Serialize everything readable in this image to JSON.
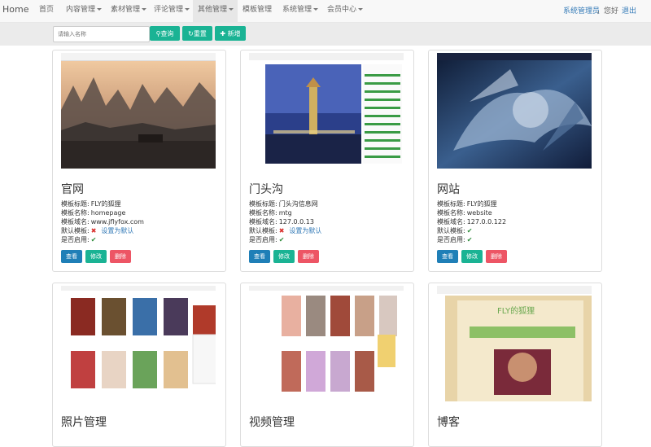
{
  "navbar": {
    "brand": "Home",
    "items": [
      {
        "label": "首页",
        "caret": false
      },
      {
        "label": "内容管理",
        "caret": true
      },
      {
        "label": "素材管理",
        "caret": true
      },
      {
        "label": "评论管理",
        "caret": true
      },
      {
        "label": "其他管理",
        "caret": true
      },
      {
        "label": "模板管理",
        "caret": false
      },
      {
        "label": "系统管理",
        "caret": true
      },
      {
        "label": "会员中心",
        "caret": true
      }
    ],
    "user": "系统管理员",
    "greeting": "，您好",
    "logout": "退出"
  },
  "toolbar": {
    "search_placeholder": "请输入名称",
    "query_label": "查询",
    "reset_label": "重置",
    "add_label": "新增"
  },
  "labels": {
    "title": "模板标题:",
    "name": "模板名称:",
    "domain": "模板域名:",
    "default": "默认模板:",
    "enabled": "是否启用:",
    "set_default": "设置为默认",
    "view": "查看",
    "edit": "修改",
    "delete": "删除"
  },
  "cards": [
    {
      "heading": "官网",
      "title": "FLY的狐狸",
      "name": "homepage",
      "domain": "www.jflyfox.com",
      "is_default": false,
      "enabled": true
    },
    {
      "heading": "门头沟",
      "title": "门头沟信息网",
      "name": "mtg",
      "domain": "127.0.0.13",
      "is_default": false,
      "enabled": true
    },
    {
      "heading": "网站",
      "title": "FLY的狐狸",
      "name": "website",
      "domain": "127.0.0.122",
      "is_default": true,
      "enabled": true
    },
    {
      "heading": "照片管理"
    },
    {
      "heading": "视频管理"
    },
    {
      "heading": "博客"
    }
  ],
  "thumb_text": {
    "blog_logo": "FLY的狐狸"
  },
  "icons": {
    "check": "check-icon",
    "cross": "cross-icon",
    "search": "search-icon",
    "refresh": "refresh-icon",
    "plus": "plus-icon"
  },
  "colors": {
    "primary": "#1ab394",
    "view": "#1f7fb7",
    "delete": "#ed5565",
    "link": "#337ab7",
    "check": "#2e8b3a",
    "cross": "#d9302c"
  }
}
